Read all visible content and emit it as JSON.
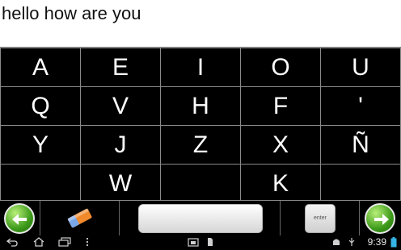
{
  "typed_text": "hello how are you",
  "keys": [
    [
      "A",
      "E",
      "I",
      "O",
      "U"
    ],
    [
      "Q",
      "V",
      "H",
      "F",
      "'"
    ],
    [
      "Y",
      "J",
      "Z",
      "X",
      "Ñ"
    ],
    [
      "",
      "W",
      "",
      "K",
      ""
    ]
  ],
  "enter_label": "enter",
  "status": {
    "time": "9:39"
  },
  "icons": {
    "back": "green-left-arrow-icon",
    "eraser": "eraser-icon",
    "forward": "green-right-arrow-icon",
    "nav_back": "nav-back-icon",
    "nav_home": "nav-home-icon",
    "nav_recents": "nav-recents-icon",
    "menu": "overflow-menu-icon"
  },
  "colors": {
    "accent_green": "#3d9a1a",
    "eraser_orange": "#f08a2c"
  }
}
